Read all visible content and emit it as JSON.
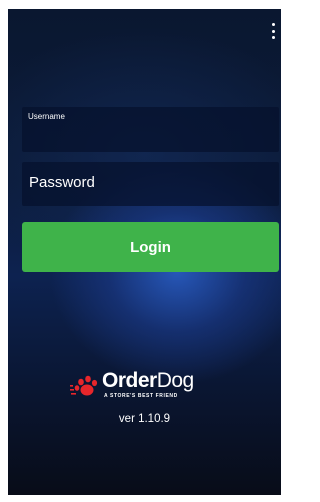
{
  "menu": {
    "icon": "more-vert-icon"
  },
  "form": {
    "username_label": "Username",
    "password_placeholder": "Password",
    "login_label": "Login"
  },
  "brand": {
    "name_bold": "Order",
    "name_light": "Dog",
    "tagline": "A STORE'S BEST FRIEND",
    "logo_icon": "paw-print-icon",
    "logo_color": "#e8262b"
  },
  "version": "ver 1.10.9",
  "colors": {
    "button_green": "#3fb34a",
    "background_dark": "#0a1730",
    "background_accent": "#2a5abe"
  }
}
